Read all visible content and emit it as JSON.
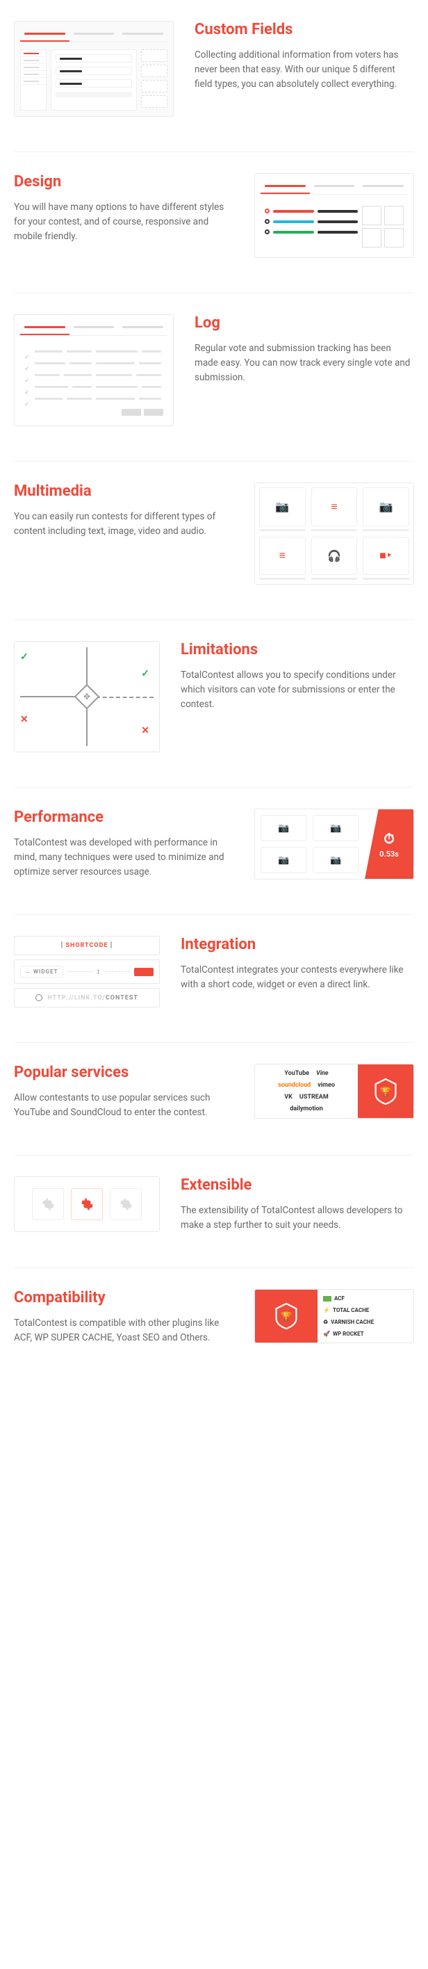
{
  "sections": {
    "customFields": {
      "title": "Custom Fields",
      "desc": "Collecting additional information from voters has never been that easy. With our unique 5 different field types, you can absolutely collect everything."
    },
    "design": {
      "title": "Design",
      "desc": "You will have many options to have different styles for your contest, and of course, responsive and mobile friendly."
    },
    "log": {
      "title": "Log",
      "desc": "Regular vote and submission tracking has been made easy. You can now track every single vote and submission."
    },
    "multimedia": {
      "title": "Multimedia",
      "desc": "You can easily run contests for different types of content including text, image, video and audio."
    },
    "limitations": {
      "title": "Limitations",
      "desc": "TotalContest allows you to specify conditions under which visitors can vote for submissions or enter the contest."
    },
    "performance": {
      "title": "Performance",
      "desc": "TotalContest was developed with performance in mind, many techniques were used to minimize and optimize server resources usage.",
      "timer": "0.53s"
    },
    "integration": {
      "title": "Integration",
      "desc": "TotalContest integrates your contests everywhere like with a short code, widget or even a direct link.",
      "shortcode_open": "[",
      "shortcode_text": "SHORTCODE",
      "shortcode_close": "]",
      "widget_label": "WIDGET",
      "url_prefix": "HTTP://LINK.TO/",
      "url_suffix": "CONTEST"
    },
    "popular": {
      "title": "Popular services",
      "desc": "Allow contestants to use popular services such YouTube and SoundCloud to enter the contest.",
      "services": [
        "YouTube",
        "Vine",
        "soundcloud",
        "vimeo",
        "VK",
        "USTREAM",
        "dailymotion"
      ]
    },
    "extensible": {
      "title": "Extensible",
      "desc": "The extensibility of TotalContest allows developers to make a step further to suit your needs."
    },
    "compatibility": {
      "title": "Compatibility",
      "desc": "TotalContest is compatible with other plugins like ACF, WP SUPER CACHE, Yoast SEO and Others.",
      "plugins": [
        "ACF",
        "TOTAL CACHE",
        "VARNISH CACHE",
        "WP ROCKET"
      ]
    }
  }
}
